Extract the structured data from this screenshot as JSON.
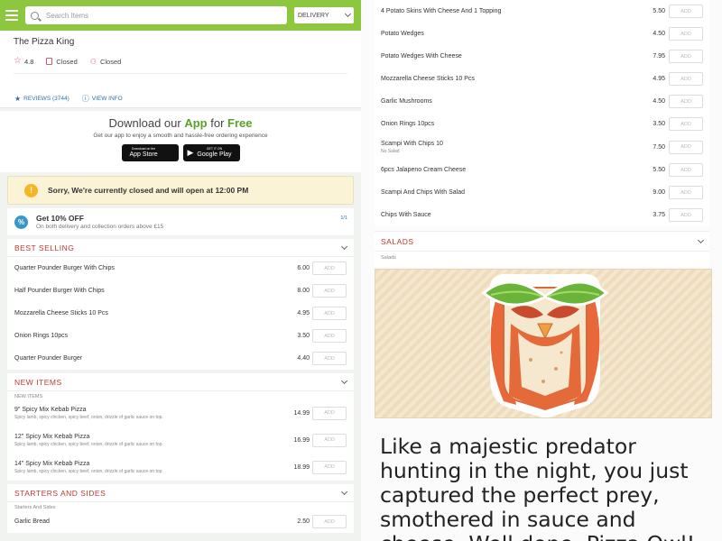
{
  "header": {
    "search_placeholder": "Search Items",
    "mode": "DELIVERY"
  },
  "restaurant": {
    "name": "The Pizza King",
    "rating": "4.8",
    "delivery_status": "Closed",
    "collection_status": "Closed",
    "reviews_link": "REVIEWS (3744)",
    "view_info_link": "VIEW INFO"
  },
  "app_promo": {
    "title_prefix": "Download our ",
    "title_app": "App",
    "title_mid": " for ",
    "title_free": "Free",
    "subtitle": "Get our app to enjoy a smooth and hassle-free ordering experience",
    "app_store_small": "Download on the",
    "app_store": "App Store",
    "google_small": "GET IT ON",
    "google": "Google Play"
  },
  "notice": {
    "text": "Sorry, We're currently closed and will open at 12:00 PM"
  },
  "offer": {
    "title": "Get 10% OFF",
    "subtitle": "On both delivery and collection orders above £15",
    "count": "1/1"
  },
  "add_label": "ADD",
  "best_selling": {
    "title": "BEST SELLING",
    "items": [
      {
        "name": "Quarter Pounder Burger With Chips",
        "price": "6.00"
      },
      {
        "name": "Half Pounder Burger With Chips",
        "price": "8.00"
      },
      {
        "name": "Mozzarella Cheese Sticks 10 Pcs",
        "price": "4.95"
      },
      {
        "name": "Onion Rings 10pcs",
        "price": "3.50"
      },
      {
        "name": "Quarter Pounder Burger",
        "price": "4.40"
      }
    ]
  },
  "new_items": {
    "title": "NEW ITEMS",
    "subtitle": "NEW ITEMS",
    "items": [
      {
        "name": "9\" Spicy Mix Kebab Pizza",
        "desc": "Spicy lamb, spicy chicken, spicy beef, onion, drizzle of garlic sauce on top.",
        "price": "14.99"
      },
      {
        "name": "12\" Spicy Mix Kebab Pizza",
        "desc": "Spicy lamb, spicy chicken, spicy beef, onion, drizzle of garlic sauce on top.",
        "price": "16.99"
      },
      {
        "name": "14\" Spicy Mix Kebab Pizza",
        "desc": "Spicy lamb, spicy chicken, spicy beef, onion, drizzle of garlic sauce on top.",
        "price": "18.99"
      }
    ]
  },
  "starters": {
    "title": "STARTERS AND SIDES",
    "subtitle": "Starters And Sides",
    "items": [
      {
        "name": "Garlic Bread",
        "price": "2.50"
      }
    ]
  },
  "right_items": [
    {
      "name": "4 Potato Skins With Cheese And 1 Topping",
      "desc": "",
      "price": "5.50"
    },
    {
      "name": "Potato Wedges",
      "desc": "",
      "price": "4.50"
    },
    {
      "name": "Potato Wedges With Cheese",
      "desc": "",
      "price": "7.95"
    },
    {
      "name": "Mozzarella Cheese Sticks 10 Pcs",
      "desc": "",
      "price": "4.95"
    },
    {
      "name": "Garlic Mushrooms",
      "desc": "",
      "price": "4.50"
    },
    {
      "name": "Onion Rings 10pcs",
      "desc": "",
      "price": "3.50"
    },
    {
      "name": "Scampi With Chips 10",
      "desc": "No Salad",
      "price": "7.50"
    },
    {
      "name": "6pcs Jalapeno Cream Cheese",
      "desc": "",
      "price": "5.50"
    },
    {
      "name": "Scampi And Chips With Salad",
      "desc": "",
      "price": "9.00"
    },
    {
      "name": "Chips With Sauce",
      "desc": "",
      "price": "3.75"
    }
  ],
  "salads": {
    "title": "SALADS",
    "subtitle": "Salads"
  },
  "caption": "Like a majestic predator hunting in the night, you just captured the perfect prey, smothered in sauce and cheese. Well done, Pizza Owl!",
  "colors": {
    "brand_green": "#8dc63f",
    "section_red": "#c0392b",
    "link_blue": "#2c6fb3",
    "warning_yellow": "#f4b627"
  }
}
